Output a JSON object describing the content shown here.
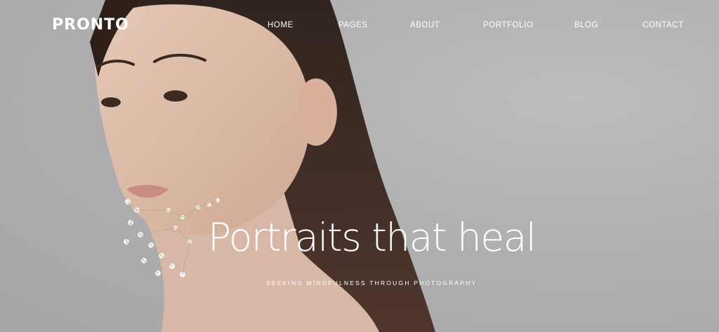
{
  "site": {
    "logo": "PRONTO"
  },
  "nav": {
    "home": "HOME",
    "pages": "PAGES",
    "about": "ABOUT",
    "portfolio": "PORTFOLIO",
    "blog": "BLOG",
    "contact": "CONTACT"
  },
  "hero": {
    "headline": "Portraits that heal",
    "tagline": "SEEKING MINDFULNESS THROUGH PHOTOGRAPHY",
    "background_color": "#b3b2b4"
  }
}
